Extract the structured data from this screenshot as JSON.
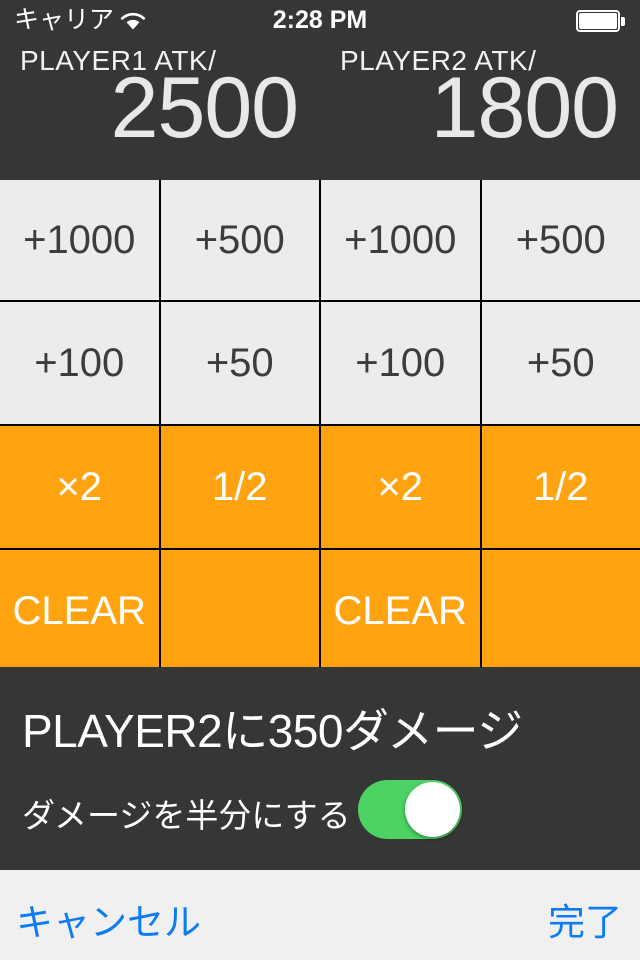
{
  "statusbar": {
    "carrier": "キャリア",
    "wifi_icon": "wifi-icon",
    "time": "2:28 PM",
    "battery_icon": "battery-full-icon"
  },
  "header": {
    "players": [
      {
        "label": "PLAYER1 ATK/",
        "value": "2500"
      },
      {
        "label": "PLAYER2 ATK/",
        "value": "1800"
      }
    ]
  },
  "grid": {
    "rows": [
      [
        {
          "label": "+1000",
          "style": "light"
        },
        {
          "label": "+500",
          "style": "light"
        },
        {
          "label": "+1000",
          "style": "light"
        },
        {
          "label": "+500",
          "style": "light"
        }
      ],
      [
        {
          "label": "+100",
          "style": "light"
        },
        {
          "label": "+50",
          "style": "light"
        },
        {
          "label": "+100",
          "style": "light"
        },
        {
          "label": "+50",
          "style": "light"
        }
      ],
      [
        {
          "label": "×2",
          "style": "orange"
        },
        {
          "label": "1/2",
          "style": "orange"
        },
        {
          "label": "×2",
          "style": "orange"
        },
        {
          "label": "1/2",
          "style": "orange"
        }
      ],
      [
        {
          "label": "CLEAR",
          "style": "orange"
        },
        {
          "label": "",
          "style": "orange"
        },
        {
          "label": "CLEAR",
          "style": "orange"
        },
        {
          "label": "",
          "style": "orange"
        }
      ]
    ]
  },
  "info": {
    "damage_text": "PLAYER2に350ダメージ",
    "half_damage_label": "ダメージを半分にする",
    "half_damage_on": true
  },
  "bottom": {
    "cancel": "キャンセル",
    "done": "完了"
  },
  "colors": {
    "dark_bg": "#363636",
    "light_button": "#ececec",
    "orange_button": "#ffa311",
    "toggle_on": "#4cd364",
    "link_blue": "#0d7cf2",
    "bottom_bar_bg": "#f0f0f0"
  }
}
